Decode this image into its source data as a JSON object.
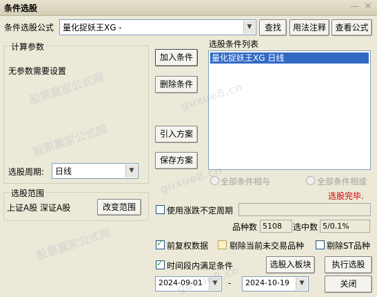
{
  "window": {
    "title": "条件选股"
  },
  "formula": {
    "label": "条件选股公式",
    "value": "量化捉妖王XG  -"
  },
  "buttons": {
    "find": "查找",
    "usage": "用法注释",
    "view_formula": "查看公式",
    "add_condition": "加入条件",
    "delete_condition": "删除条件",
    "import_scheme": "引入方案",
    "save_scheme": "保存方案",
    "change_scope": "改变范围",
    "pick_into_block": "选股入板块",
    "run_pick": "执行选股",
    "close": "关闭"
  },
  "params_group": {
    "title": "计算参数",
    "note": "无参数需要设置"
  },
  "period": {
    "label": "选股周期:",
    "value": "日线"
  },
  "condition_list": {
    "title": "选股条件列表",
    "items": [
      "量化捉妖王XG  日线"
    ]
  },
  "logic": {
    "all_and": "全部条件相与",
    "all_or": "全部条件相或",
    "status": "选股完毕."
  },
  "scope_group": {
    "title": "选股范围",
    "text": "上证A股  深证A股"
  },
  "variable_period": {
    "label": "使用涨跌不定周期"
  },
  "stats": {
    "count_label": "品种数",
    "count_value": "5108",
    "selected_label": "选中数",
    "selected_value": "5/0.1%"
  },
  "options": {
    "prev_rights": "前复权数据",
    "exclude_untraded": "剔除当前未交易品种",
    "exclude_st": "剔除ST品种",
    "time_range": "时间段内满足条件"
  },
  "dates": {
    "start": "2024-09-01",
    "dash": "-",
    "end": "2024-10-19"
  },
  "watermarks": [
    "股票赢家公式网",
    "guxue8.cn"
  ],
  "colors": {
    "status_red": "#cc0000",
    "selection_blue": "#316ac5"
  }
}
